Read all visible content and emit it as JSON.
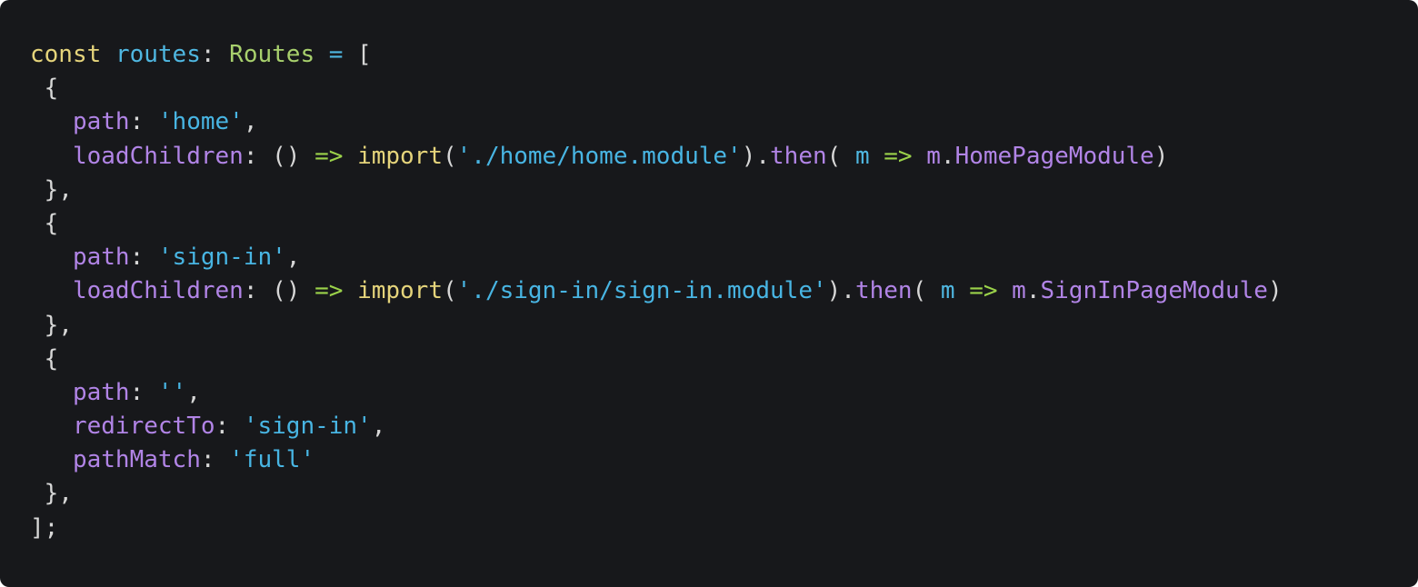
{
  "editor": {
    "background": "#17181b",
    "colors": {
      "default": "#d7d7d7",
      "keyword": "#e5d47b",
      "type": "#a8d06d",
      "variable": "#4fb7e1",
      "property": "#b184e6",
      "string": "#48b5e3",
      "operator": "#9bd24a",
      "punctuation": "#d7d7d7"
    },
    "lines": [
      {
        "tokens": [
          {
            "text": "const",
            "kind": "keyword"
          },
          {
            "text": " ",
            "kind": "default"
          },
          {
            "text": "routes",
            "kind": "variable"
          },
          {
            "text": ": ",
            "kind": "punctuation"
          },
          {
            "text": "Routes",
            "kind": "type"
          },
          {
            "text": " ",
            "kind": "default"
          },
          {
            "text": "=",
            "kind": "variable"
          },
          {
            "text": " [",
            "kind": "punctuation"
          }
        ]
      },
      {
        "tokens": [
          {
            "text": " {",
            "kind": "punctuation"
          }
        ]
      },
      {
        "tokens": [
          {
            "text": "   ",
            "kind": "default"
          },
          {
            "text": "path",
            "kind": "property"
          },
          {
            "text": ": ",
            "kind": "punctuation"
          },
          {
            "text": "'home'",
            "kind": "string"
          },
          {
            "text": ",",
            "kind": "punctuation"
          }
        ]
      },
      {
        "tokens": [
          {
            "text": "   ",
            "kind": "default"
          },
          {
            "text": "loadChildren",
            "kind": "property"
          },
          {
            "text": ": () ",
            "kind": "punctuation"
          },
          {
            "text": "=>",
            "kind": "operator"
          },
          {
            "text": " ",
            "kind": "default"
          },
          {
            "text": "import",
            "kind": "keyword"
          },
          {
            "text": "(",
            "kind": "punctuation"
          },
          {
            "text": "'./home/home.module'",
            "kind": "string"
          },
          {
            "text": ").",
            "kind": "punctuation"
          },
          {
            "text": "then",
            "kind": "property"
          },
          {
            "text": "( ",
            "kind": "punctuation"
          },
          {
            "text": "m",
            "kind": "variable"
          },
          {
            "text": " ",
            "kind": "default"
          },
          {
            "text": "=>",
            "kind": "operator"
          },
          {
            "text": " ",
            "kind": "default"
          },
          {
            "text": "m",
            "kind": "property"
          },
          {
            "text": ".",
            "kind": "punctuation"
          },
          {
            "text": "HomePageModule",
            "kind": "property"
          },
          {
            "text": ")",
            "kind": "punctuation"
          }
        ]
      },
      {
        "tokens": [
          {
            "text": " },",
            "kind": "punctuation"
          }
        ]
      },
      {
        "tokens": [
          {
            "text": " {",
            "kind": "punctuation"
          }
        ]
      },
      {
        "tokens": [
          {
            "text": "   ",
            "kind": "default"
          },
          {
            "text": "path",
            "kind": "property"
          },
          {
            "text": ": ",
            "kind": "punctuation"
          },
          {
            "text": "'sign-in'",
            "kind": "string"
          },
          {
            "text": ",",
            "kind": "punctuation"
          }
        ]
      },
      {
        "tokens": [
          {
            "text": "   ",
            "kind": "default"
          },
          {
            "text": "loadChildren",
            "kind": "property"
          },
          {
            "text": ": () ",
            "kind": "punctuation"
          },
          {
            "text": "=>",
            "kind": "operator"
          },
          {
            "text": " ",
            "kind": "default"
          },
          {
            "text": "import",
            "kind": "keyword"
          },
          {
            "text": "(",
            "kind": "punctuation"
          },
          {
            "text": "'./sign-in/sign-in.module'",
            "kind": "string"
          },
          {
            "text": ").",
            "kind": "punctuation"
          },
          {
            "text": "then",
            "kind": "property"
          },
          {
            "text": "( ",
            "kind": "punctuation"
          },
          {
            "text": "m",
            "kind": "variable"
          },
          {
            "text": " ",
            "kind": "default"
          },
          {
            "text": "=>",
            "kind": "operator"
          },
          {
            "text": " ",
            "kind": "default"
          },
          {
            "text": "m",
            "kind": "property"
          },
          {
            "text": ".",
            "kind": "punctuation"
          },
          {
            "text": "SignInPageModule",
            "kind": "property"
          },
          {
            "text": ")",
            "kind": "punctuation"
          }
        ]
      },
      {
        "tokens": [
          {
            "text": " },",
            "kind": "punctuation"
          }
        ]
      },
      {
        "tokens": [
          {
            "text": " {",
            "kind": "punctuation"
          }
        ]
      },
      {
        "tokens": [
          {
            "text": "   ",
            "kind": "default"
          },
          {
            "text": "path",
            "kind": "property"
          },
          {
            "text": ": ",
            "kind": "punctuation"
          },
          {
            "text": "''",
            "kind": "string"
          },
          {
            "text": ",",
            "kind": "punctuation"
          }
        ]
      },
      {
        "tokens": [
          {
            "text": "   ",
            "kind": "default"
          },
          {
            "text": "redirectTo",
            "kind": "property"
          },
          {
            "text": ": ",
            "kind": "punctuation"
          },
          {
            "text": "'sign-in'",
            "kind": "string"
          },
          {
            "text": ",",
            "kind": "punctuation"
          }
        ]
      },
      {
        "tokens": [
          {
            "text": "   ",
            "kind": "default"
          },
          {
            "text": "pathMatch",
            "kind": "property"
          },
          {
            "text": ": ",
            "kind": "punctuation"
          },
          {
            "text": "'full'",
            "kind": "string"
          }
        ]
      },
      {
        "tokens": [
          {
            "text": " },",
            "kind": "punctuation"
          }
        ]
      },
      {
        "tokens": [
          {
            "text": "];",
            "kind": "punctuation"
          }
        ]
      }
    ]
  }
}
